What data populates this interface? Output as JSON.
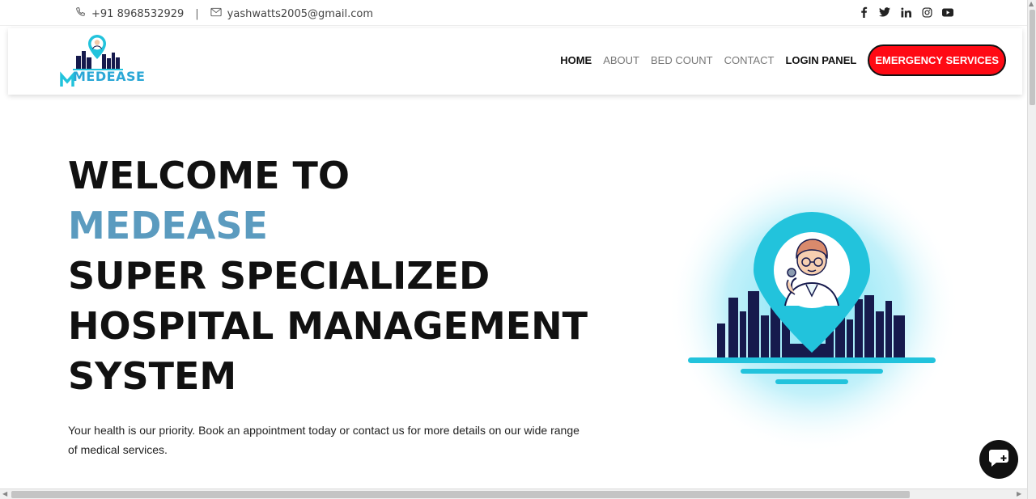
{
  "topbar": {
    "phone": "+91 8968532929",
    "separator": "|",
    "email": "yashwatts2005@gmail.com",
    "social_icons": [
      "facebook-icon",
      "twitter-icon",
      "linkedin-icon",
      "instagram-icon",
      "youtube-icon"
    ]
  },
  "header": {
    "logo_text": "MEDEASE",
    "nav": {
      "home": "HOME",
      "about": "ABOUT",
      "bed_count": "BED COUNT",
      "contact": "CONTACT",
      "login_panel": "LOGIN PANEL",
      "emergency": "EMERGENCY SERVICES"
    }
  },
  "hero": {
    "line1": "WELCOME TO",
    "brand": "MEDEASE",
    "line3": "SUPER SPECIALIZED",
    "line4": "HOSPITAL MANAGEMENT",
    "line5": "SYSTEM",
    "description": "Your health is our priority. Book an appointment today or contact us for more details on our wide range of medical services."
  },
  "colors": {
    "brand_blue": "#5b9bbf",
    "emergency_red": "#ff0a14",
    "cyan": "#22c3dc",
    "navy": "#161a4d"
  }
}
